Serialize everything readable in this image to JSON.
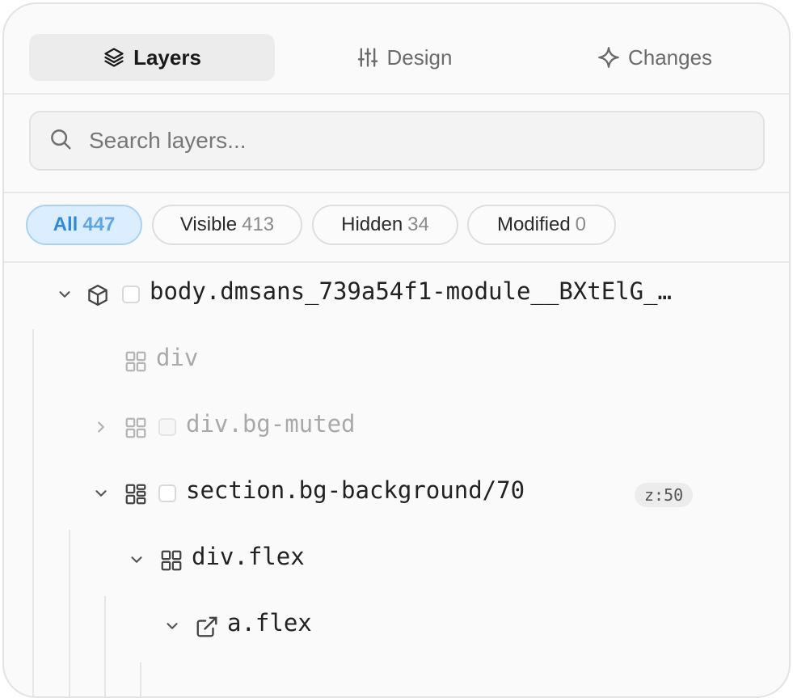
{
  "tabs": [
    {
      "label": "Layers",
      "icon": "layers-icon",
      "active": true
    },
    {
      "label": "Design",
      "icon": "sliders-icon",
      "active": false
    },
    {
      "label": "Changes",
      "icon": "sparkle-icon",
      "active": false
    }
  ],
  "search": {
    "placeholder": "Search layers...",
    "value": ""
  },
  "filters": [
    {
      "label": "All",
      "count": "447",
      "active": true
    },
    {
      "label": "Visible",
      "count": "413",
      "active": false
    },
    {
      "label": "Hidden",
      "count": "34",
      "active": false
    },
    {
      "label": "Modified",
      "count": "0",
      "active": false
    }
  ],
  "tree": [
    {
      "label": "body.dmsans_739a54f1-module__BXtElG_…",
      "icon": "cube-icon",
      "expanded": true,
      "hidden": false
    },
    {
      "label": "div",
      "icon": "grid-icon",
      "hidden": true
    },
    {
      "label": "div.bg-muted",
      "icon": "grid-icon",
      "expanded": false,
      "hidden": true
    },
    {
      "label": "section.bg-background/70",
      "icon": "layout-icon",
      "expanded": true,
      "hidden": false,
      "badge": "z:50"
    },
    {
      "label": "div.flex",
      "icon": "grid-icon",
      "expanded": true,
      "hidden": false
    },
    {
      "label": "a.flex",
      "icon": "external-link-icon",
      "expanded": true,
      "hidden": false
    }
  ],
  "colors": {
    "accent": "#2a8ae0",
    "accent_bg": "#dbeeff",
    "panel_bg": "#fafafa"
  }
}
